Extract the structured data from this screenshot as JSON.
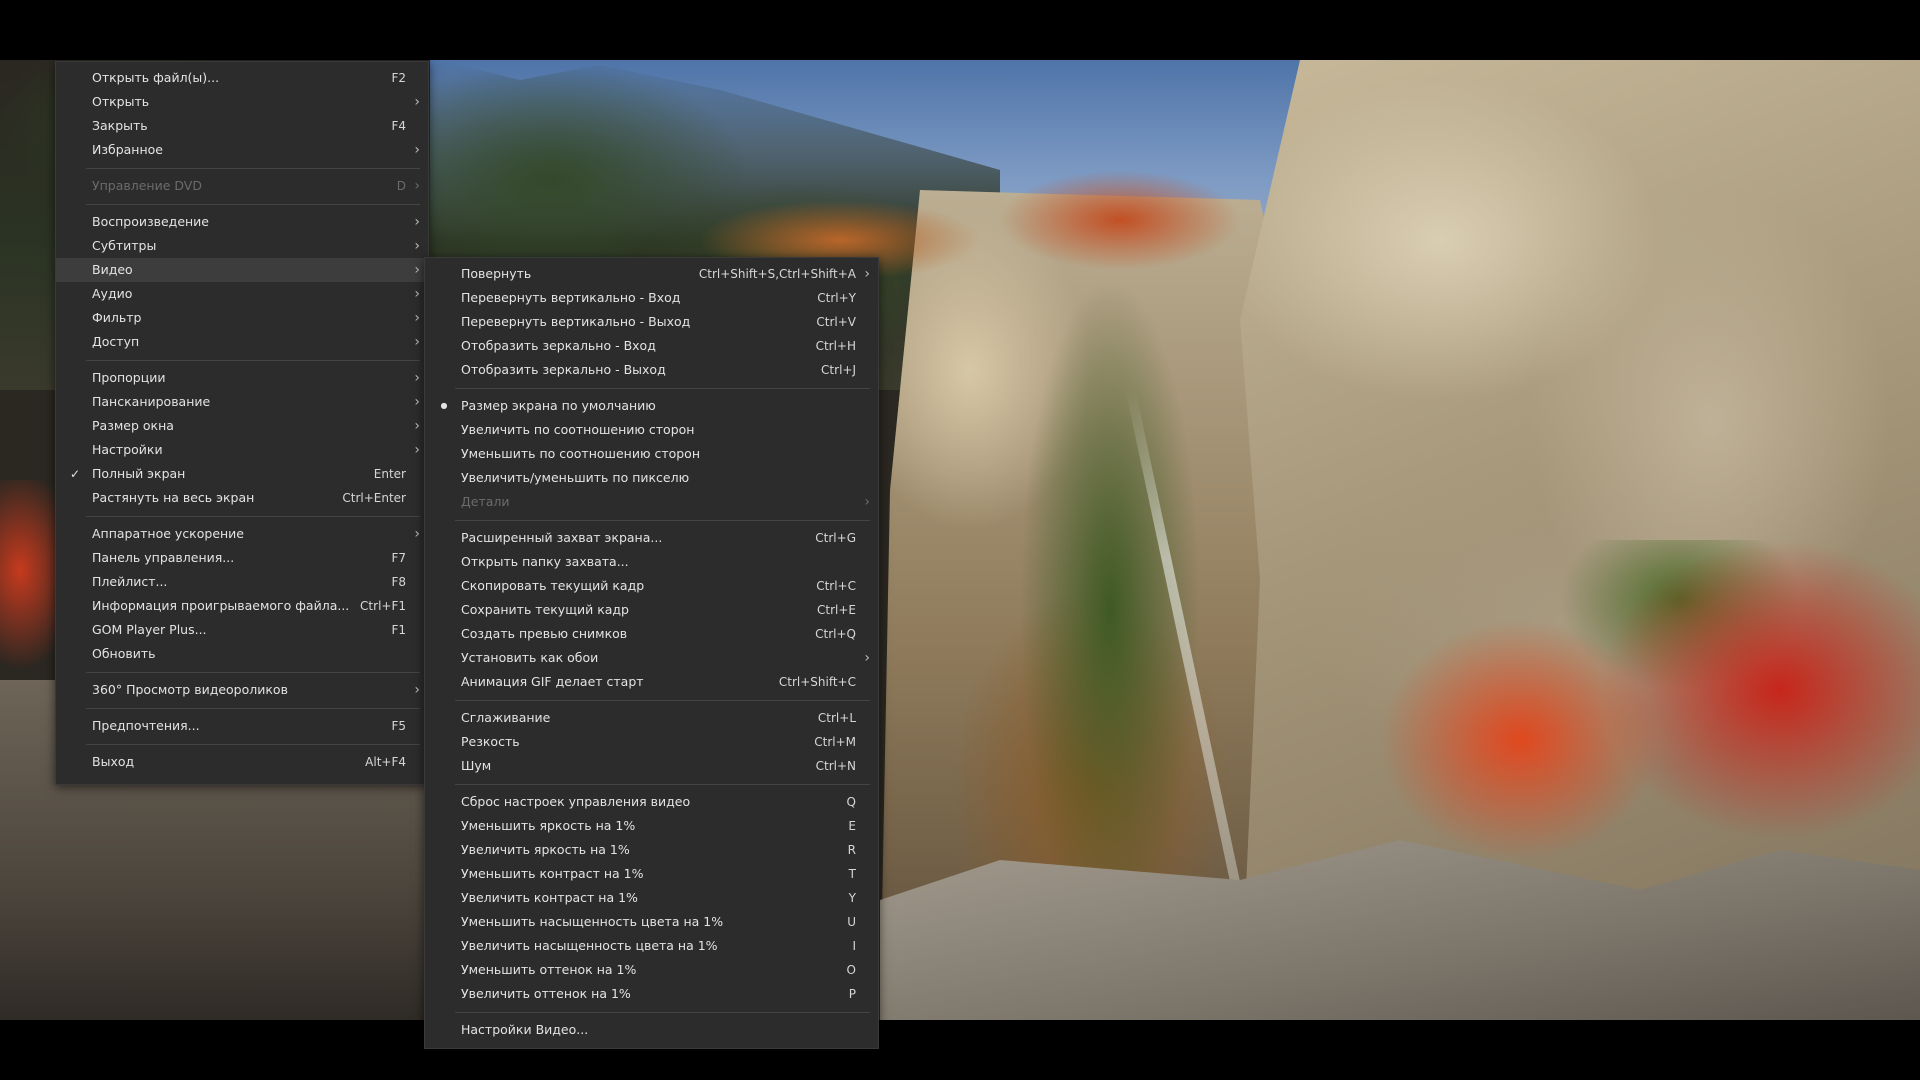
{
  "main_menu": {
    "groups": [
      [
        {
          "label": "Открыть файл(ы)...",
          "shortcut": "F2"
        },
        {
          "label": "Открыть",
          "submenu": true
        },
        {
          "label": "Закрыть",
          "shortcut": "F4"
        },
        {
          "label": "Избранное",
          "submenu": true
        }
      ],
      [
        {
          "label": "Управление DVD",
          "shortcut": "D",
          "submenu": true,
          "disabled": true
        }
      ],
      [
        {
          "label": "Воспроизведение",
          "submenu": true
        },
        {
          "label": "Субтитры",
          "submenu": true
        },
        {
          "label": "Видео",
          "submenu": true,
          "active": true
        },
        {
          "label": "Аудио",
          "submenu": true
        },
        {
          "label": "Фильтр",
          "submenu": true
        },
        {
          "label": "Доступ",
          "submenu": true
        }
      ],
      [
        {
          "label": "Пропорции",
          "submenu": true
        },
        {
          "label": "Пансканирование",
          "submenu": true
        },
        {
          "label": "Размер окна",
          "submenu": true
        },
        {
          "label": "Настройки",
          "submenu": true
        },
        {
          "label": "Полный экран",
          "shortcut": "Enter",
          "checked": "check"
        },
        {
          "label": "Растянуть на весь экран",
          "shortcut": "Ctrl+Enter"
        }
      ],
      [
        {
          "label": "Аппаратное ускорение",
          "submenu": true
        },
        {
          "label": "Панель управления...",
          "shortcut": "F7"
        },
        {
          "label": "Плейлист...",
          "shortcut": "F8"
        },
        {
          "label": "Информация проигрываемого файла...",
          "shortcut": "Ctrl+F1"
        },
        {
          "label": "GOM Player Plus...",
          "shortcut": "F1"
        },
        {
          "label": "Обновить"
        }
      ],
      [
        {
          "label": "360° Просмотр видеороликов",
          "submenu": true
        }
      ],
      [
        {
          "label": "Предпочтения...",
          "shortcut": "F5"
        }
      ],
      [
        {
          "label": "Выход",
          "shortcut": "Alt+F4"
        }
      ]
    ]
  },
  "video_submenu": {
    "groups": [
      [
        {
          "label": "Повернуть",
          "shortcut": "Ctrl+Shift+S,Ctrl+Shift+A",
          "submenu": true
        },
        {
          "label": "Перевернуть вертикально - Вход",
          "shortcut": "Ctrl+Y"
        },
        {
          "label": "Перевернуть вертикально - Выход",
          "shortcut": "Ctrl+V"
        },
        {
          "label": "Отобразить зеркально - Вход",
          "shortcut": "Ctrl+H"
        },
        {
          "label": "Отобразить зеркально - Выход",
          "shortcut": "Ctrl+J"
        }
      ],
      [
        {
          "label": "Размер экрана по умолчанию",
          "checked": "dot"
        },
        {
          "label": "Увеличить по соотношению сторон"
        },
        {
          "label": "Уменьшить по соотношению сторон"
        },
        {
          "label": "Увеличить/уменьшить по пикселю"
        },
        {
          "label": "Детали",
          "submenu": true,
          "disabled": true
        }
      ],
      [
        {
          "label": "Расширенный захват экрана...",
          "shortcut": "Ctrl+G"
        },
        {
          "label": "Открыть папку захвата..."
        },
        {
          "label": "Скопировать текущий кадр",
          "shortcut": "Ctrl+C"
        },
        {
          "label": "Сохранить текущий кадр",
          "shortcut": "Ctrl+E"
        },
        {
          "label": "Создать превью снимков",
          "shortcut": "Ctrl+Q"
        },
        {
          "label": "Установить как обои",
          "submenu": true
        },
        {
          "label": "Анимация GIF делает старт",
          "shortcut": "Ctrl+Shift+C"
        }
      ],
      [
        {
          "label": "Сглаживание",
          "shortcut": "Ctrl+L"
        },
        {
          "label": "Резкость",
          "shortcut": "Ctrl+M"
        },
        {
          "label": "Шум",
          "shortcut": "Ctrl+N"
        }
      ],
      [
        {
          "label": "Сброс настроек управления видео",
          "shortcut": "Q"
        },
        {
          "label": "Уменьшить яркость на 1%",
          "shortcut": "E"
        },
        {
          "label": "Увеличить яркость на 1%",
          "shortcut": "R"
        },
        {
          "label": "Уменьшить контраст на 1%",
          "shortcut": "T"
        },
        {
          "label": "Увеличить контраст на 1%",
          "shortcut": "Y"
        },
        {
          "label": "Уменьшить насыщенность цвета на 1%",
          "shortcut": "U"
        },
        {
          "label": "Увеличить насыщенность цвета на 1%",
          "shortcut": "I"
        },
        {
          "label": "Уменьшить оттенок на 1%",
          "shortcut": "O"
        },
        {
          "label": "Увеличить оттенок на 1%",
          "shortcut": "P"
        }
      ],
      [
        {
          "label": "Настройки Видео..."
        }
      ]
    ]
  },
  "icons": {
    "submenu_arrow": "chevron-right-icon",
    "check": "check-icon",
    "dot": "radio-dot-icon"
  },
  "colors": {
    "menu_bg": "#2c2c2c",
    "menu_text": "#e3e3e3",
    "disabled_text": "#6b6b6b",
    "highlight_bg": "#3d3d3d",
    "separator": "#454545"
  }
}
